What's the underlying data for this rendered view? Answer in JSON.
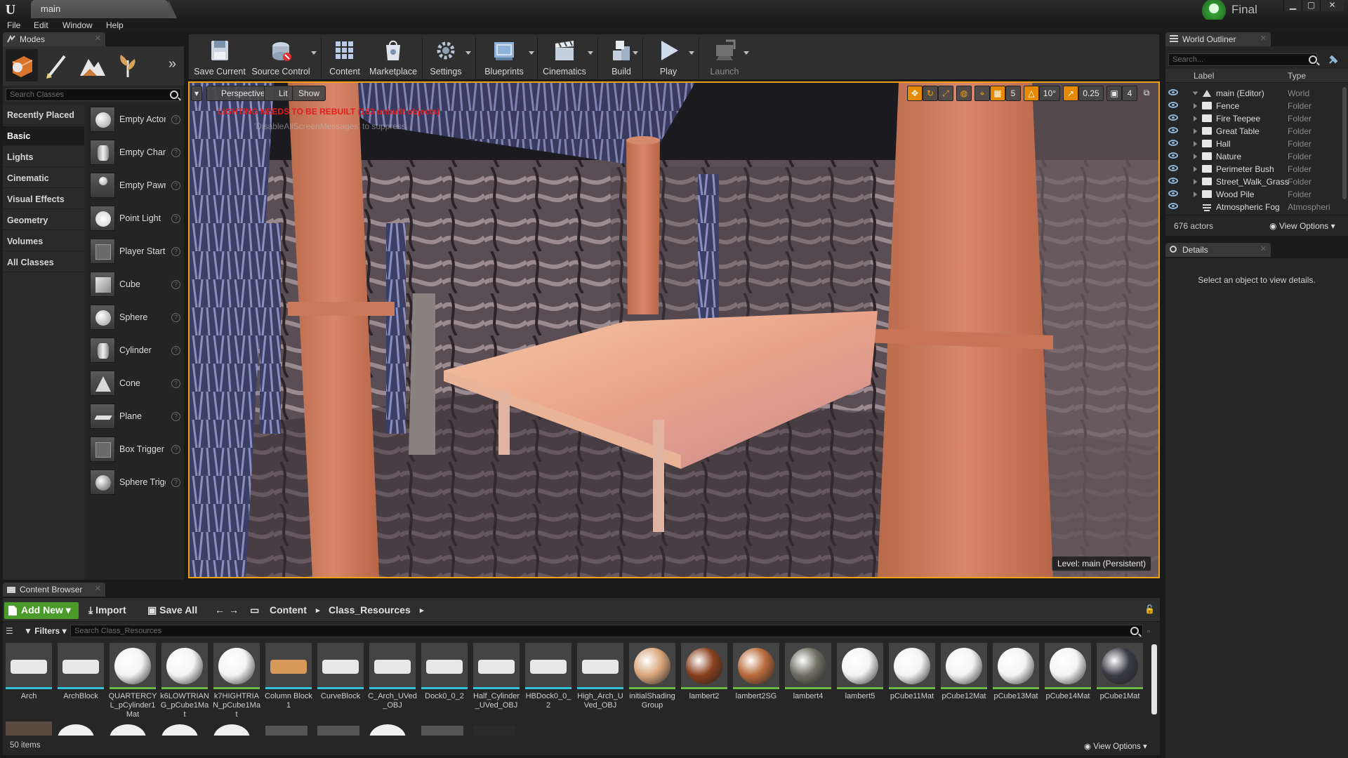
{
  "window": {
    "doc_tab": "main",
    "build_label": "Final",
    "minimize": "▁",
    "maximize": "▢",
    "close": "✕"
  },
  "menu": [
    "File",
    "Edit",
    "Window",
    "Help"
  ],
  "modes": {
    "tab_label": "Modes",
    "search_placeholder": "Search Classes",
    "categories": [
      "Recently Placed",
      "Basic",
      "Lights",
      "Cinematic",
      "Visual Effects",
      "Geometry",
      "Volumes",
      "All Classes"
    ],
    "active_category": "Basic",
    "items": [
      {
        "label": "Empty Actor",
        "icon": "sphere-icon"
      },
      {
        "label": "Empty Character",
        "icon": "character-icon"
      },
      {
        "label": "Empty Pawn",
        "icon": "pawn-icon"
      },
      {
        "label": "Point Light",
        "icon": "bulb-icon"
      },
      {
        "label": "Player Start",
        "icon": "player-start-icon"
      },
      {
        "label": "Cube",
        "icon": "cube-icon"
      },
      {
        "label": "Sphere",
        "icon": "sphere-icon"
      },
      {
        "label": "Cylinder",
        "icon": "cylinder-icon"
      },
      {
        "label": "Cone",
        "icon": "cone-icon"
      },
      {
        "label": "Plane",
        "icon": "plane-icon"
      },
      {
        "label": "Box Trigger",
        "icon": "box-trigger-icon"
      },
      {
        "label": "Sphere Trigger",
        "icon": "sphere-trigger-icon"
      }
    ],
    "help_glyph": "?"
  },
  "toolbar": {
    "buttons": [
      {
        "label": "Save Current",
        "icon": "save-icon"
      },
      {
        "label": "Source Control",
        "icon": "source-control-icon"
      },
      {
        "label": "Content",
        "icon": "content-icon"
      },
      {
        "label": "Marketplace",
        "icon": "marketplace-icon"
      },
      {
        "label": "Settings",
        "icon": "settings-icon"
      },
      {
        "label": "Blueprints",
        "icon": "blueprints-icon"
      },
      {
        "label": "Cinematics",
        "icon": "cinematics-icon"
      },
      {
        "label": "Build",
        "icon": "build-icon"
      },
      {
        "label": "Play",
        "icon": "play-icon"
      },
      {
        "label": "Launch",
        "icon": "launch-icon"
      }
    ]
  },
  "viewport": {
    "view_mode": "Perspective",
    "lighting": "Lit",
    "show": "Show",
    "warning": "LIGHTING NEEDS TO BE REBUILT (163 unbuilt objects)",
    "hint": "'DisableAllScreenMessages' to suppress",
    "grid_snap": "5",
    "rotation_snap": "10°",
    "scale_snap": "0.25",
    "camera_speed": "4",
    "level_label": "Level:  main (Persistent)"
  },
  "outliner": {
    "tab_label": "World Outliner",
    "search_placeholder": "Search...",
    "col_label": "Label",
    "col_type": "Type",
    "rows": [
      {
        "label": "main (Editor)",
        "type": "World"
      },
      {
        "label": "Fence",
        "type": "Folder"
      },
      {
        "label": "Fire Teepee",
        "type": "Folder"
      },
      {
        "label": "Great Table",
        "type": "Folder"
      },
      {
        "label": "Hall",
        "type": "Folder"
      },
      {
        "label": "Nature",
        "type": "Folder"
      },
      {
        "label": "Perimeter Bush",
        "type": "Folder"
      },
      {
        "label": "Street_Walk_Grass",
        "type": "Folder"
      },
      {
        "label": "Wood Pile",
        "type": "Folder"
      },
      {
        "label": "Atmospheric Fog",
        "type": "Atmospheri"
      }
    ],
    "actor_count": "676 actors",
    "view_options": "View Options"
  },
  "details": {
    "tab_label": "Details",
    "empty_message": "Select an object to view details."
  },
  "content_browser": {
    "tab_label": "Content Browser",
    "add_new": "Add New",
    "import": "Import",
    "save_all": "Save All",
    "path": [
      "Content",
      "Class_Resources"
    ],
    "filters": "Filters",
    "search_placeholder": "Search Class_Resources",
    "item_count": "50 items",
    "view_options": "View Options",
    "assets": [
      {
        "label": "Arch",
        "kind": "mesh",
        "color": "#e8e8e8"
      },
      {
        "label": "ArchBlock",
        "kind": "mesh",
        "color": "#e8e8e8"
      },
      {
        "label": "QUARTERCYL_pCylinder1 Mat",
        "kind": "mat",
        "color": "#f4f4f4"
      },
      {
        "label": "k6LOWTRIANG_pCube1Mat",
        "kind": "mat",
        "color": "#f4f4f4"
      },
      {
        "label": "k7HIGHTRIAN_pCube1Mat",
        "kind": "mat",
        "color": "#f4f4f4"
      },
      {
        "label": "Column Block1",
        "kind": "mesh",
        "color": "#d79a5a"
      },
      {
        "label": "CurveBlock",
        "kind": "mesh",
        "color": "#e8e8e8"
      },
      {
        "label": "C_Arch_UVed_OBJ",
        "kind": "mesh",
        "color": "#e8e8e8"
      },
      {
        "label": "Dock0_0_2",
        "kind": "mesh",
        "color": "#e8e8e8"
      },
      {
        "label": "Half_Cylinder_UVed_OBJ",
        "kind": "mesh",
        "color": "#e8e8e8"
      },
      {
        "label": "HBDock0_0_2",
        "kind": "mesh",
        "color": "#e8e8e8"
      },
      {
        "label": "High_Arch_UVed_OBJ",
        "kind": "mesh",
        "color": "#e8e8e8"
      },
      {
        "label": "initialShadingGroup",
        "kind": "mat",
        "color": "#d9a67a"
      },
      {
        "label": "lambert2",
        "kind": "mat",
        "color": "#8a3f1c"
      },
      {
        "label": "lambert2SG",
        "kind": "mat",
        "color": "#b86a3a"
      },
      {
        "label": "lambert4",
        "kind": "mat",
        "color": "#6e6e62"
      },
      {
        "label": "lambert5",
        "kind": "mat",
        "color": "#f4f4f4"
      },
      {
        "label": "pCube11Mat",
        "kind": "mat",
        "color": "#f4f4f4"
      },
      {
        "label": "pCube12Mat",
        "kind": "mat",
        "color": "#f4f4f4"
      },
      {
        "label": "pCube13Mat",
        "kind": "mat",
        "color": "#f4f4f4"
      },
      {
        "label": "pCube14Mat",
        "kind": "mat",
        "color": "#f4f4f4"
      },
      {
        "label": "pCube1Mat",
        "kind": "mat",
        "color": "#3a3a44"
      }
    ]
  },
  "colors": {
    "accent": "#f0a010",
    "add_new_green": "#4b9b2c",
    "warning_red": "#e31d1d",
    "mesh_underline": "#31c4d8",
    "material_underline": "#6dbb47"
  }
}
